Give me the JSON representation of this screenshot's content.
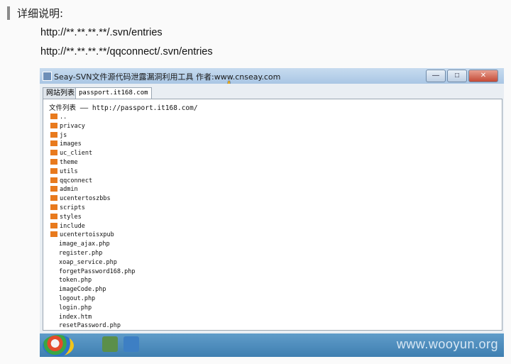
{
  "heading": "详细说明:",
  "urls": [
    "http://**.**.**.**/.svn/entries",
    "http://**.**.**.**/qqconnect/.svn/entries"
  ],
  "window": {
    "title": "Seay-SVN文件源代码泄露漏洞利用工具  作者:www.cnseay.com",
    "buttons": [
      "—",
      "□",
      "✕"
    ]
  },
  "tabs": [
    "网站列表",
    "passport.it168.com"
  ],
  "list_header": "文件列表 —— http://passport.it168.com/",
  "folders": [
    "..",
    "privacy",
    "js",
    "images",
    "uc_client",
    "theme",
    "utils",
    "qqconnect",
    "admin",
    "ucentertoszbbs",
    "scripts",
    "styles",
    "include",
    "ucentertoisxpub"
  ],
  "files": [
    "image_ajax.php",
    "register.php",
    "xoap_service.php",
    "forgetPassword168.php",
    "token.php",
    "imageCode.php",
    "logout.php",
    "login.php",
    "index.htm",
    "resetPassword.php"
  ],
  "watermark": "www.wooyun.org",
  "colors": {
    "folder": "#e87a1e",
    "taskbar": "#4a88bb"
  }
}
